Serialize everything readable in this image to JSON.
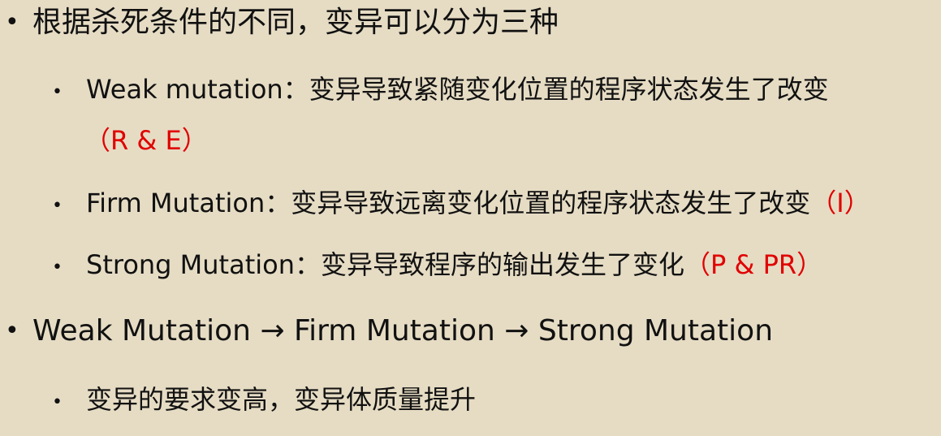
{
  "bullet_main": "•",
  "bullet_sub": "•",
  "items": [
    {
      "text": "根据杀死条件的不同，变异可以分为三种"
    },
    {
      "text": "Weak mutation：变异导致紧随变化位置的程序状态发生了改变"
    },
    {
      "tag": "（R & E）"
    },
    {
      "text": "Firm Mutation：变异导致远离变化位置的程序状态发生了改变",
      "tag": "（I）"
    },
    {
      "text": "Strong Mutation：变异导致程序的输出发生了变化",
      "tag": "（P & PR）"
    },
    {
      "text": "Weak Mutation → Firm Mutation → Strong Mutation"
    },
    {
      "text": "变异的要求变高，变异体质量提升"
    }
  ],
  "colors": {
    "background": "#e6dcc4",
    "text": "#111111",
    "accent_red": "#e00000"
  }
}
